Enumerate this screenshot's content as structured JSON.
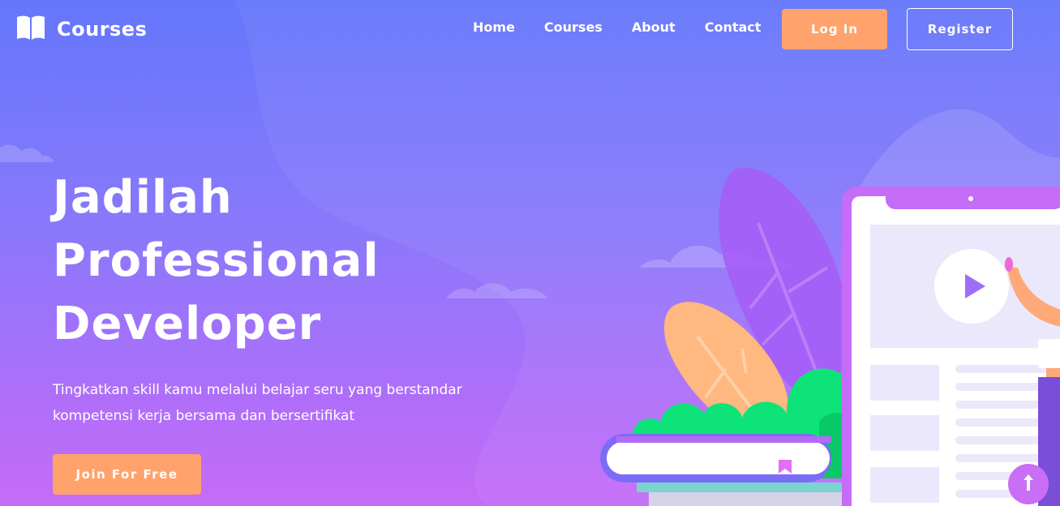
{
  "brand": {
    "label": "Courses",
    "icon": "open-book-icon"
  },
  "nav": {
    "links": [
      "Home",
      "Courses",
      "About",
      "Contact"
    ],
    "login_label": "Log In",
    "register_label": "Register"
  },
  "hero": {
    "title_lines": [
      "Jadilah",
      "Professional",
      "Developer"
    ],
    "subtitle_lines": [
      "Tingkatkan skill kamu melalui belajar seru yang berstandar",
      "kompetensi kerja bersama dan bersertifikat"
    ],
    "cta_label": "Join For Free"
  },
  "colors": {
    "accent": "#ffa26b",
    "gradient_top": "#6477fb",
    "gradient_bottom": "#c56cf8",
    "scroll_button": "#c96ef5"
  },
  "icons": {
    "scroll_top": "arrow-up-icon",
    "play": "play-icon",
    "bookmark": "bookmark-icon"
  }
}
